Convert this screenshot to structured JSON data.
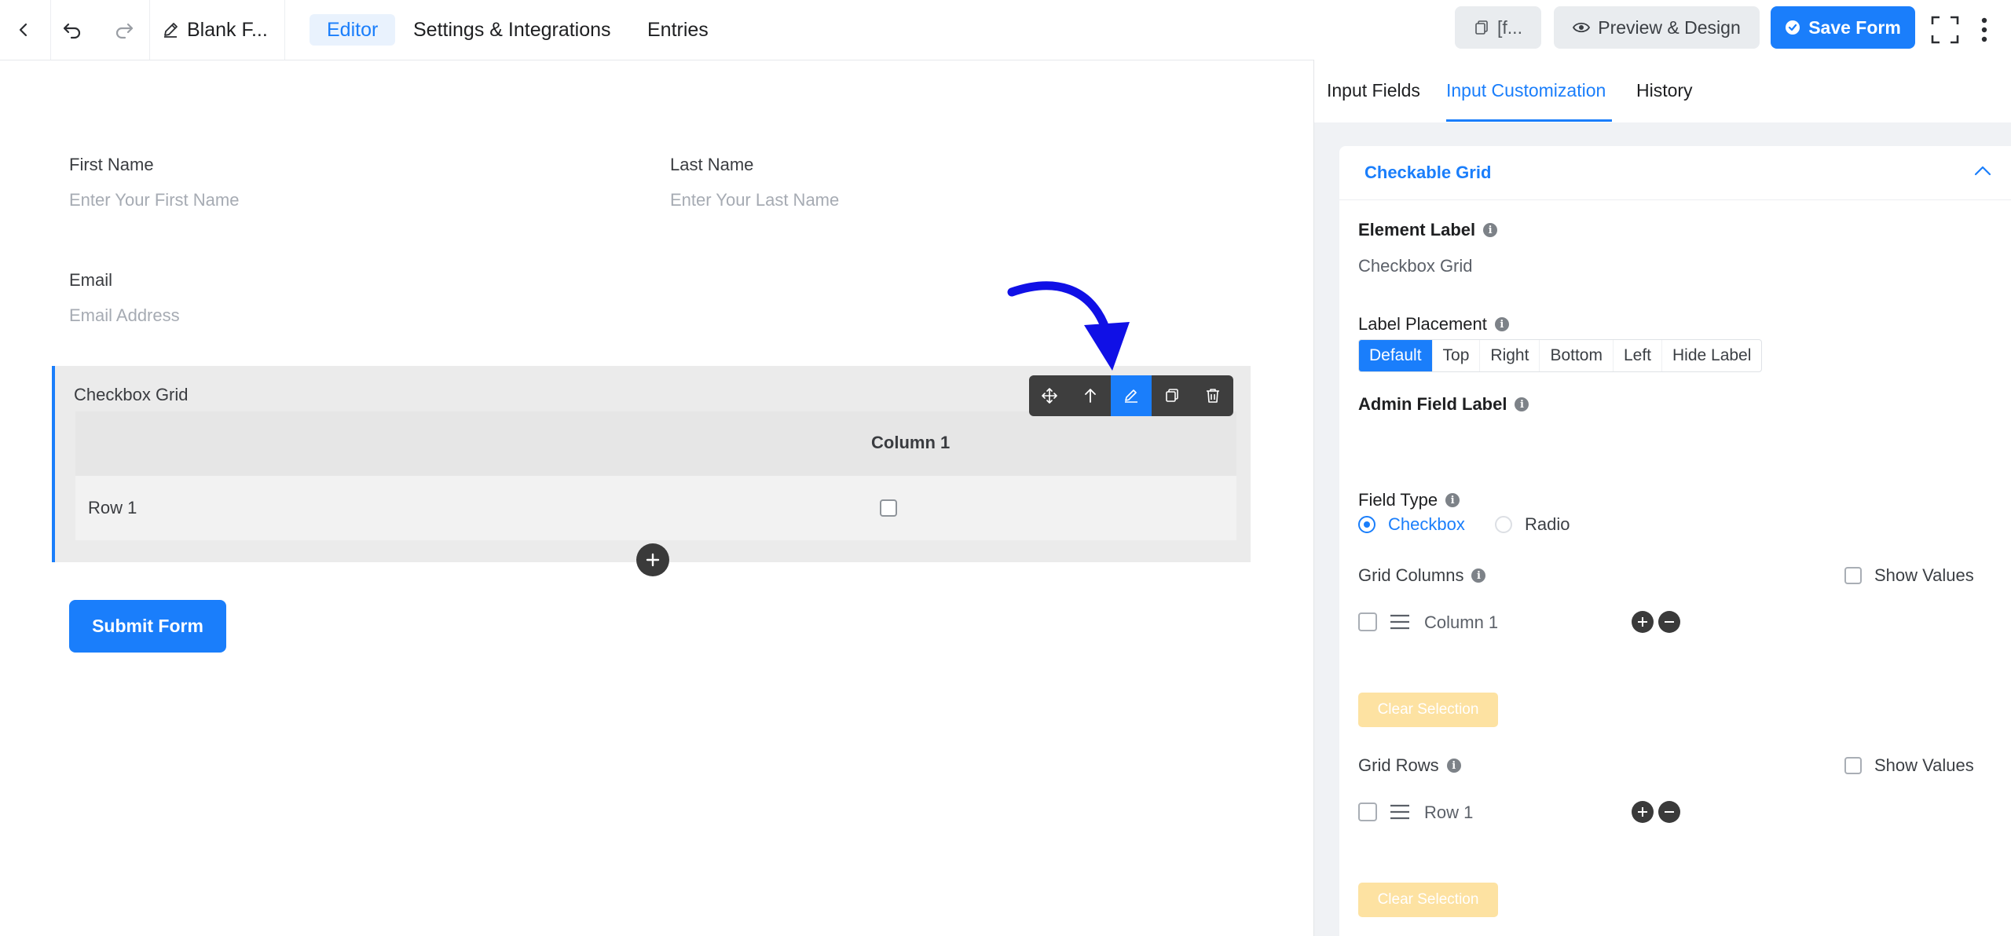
{
  "topbar": {
    "form_title": "Blank F...",
    "tabs": [
      {
        "label": "Editor"
      },
      {
        "label": "Settings & Integrations"
      },
      {
        "label": "Entries"
      }
    ],
    "shortcode_label": "[f...",
    "preview_label": "Preview & Design",
    "save_label": "Save Form"
  },
  "form": {
    "first_name": {
      "label": "First Name",
      "placeholder": "Enter Your First Name"
    },
    "last_name": {
      "label": "Last Name",
      "placeholder": "Enter Your Last Name"
    },
    "email": {
      "label": "Email",
      "placeholder": "Email Address"
    },
    "checkbox_grid": {
      "label": "Checkbox Grid",
      "columns": [
        "Column 1"
      ],
      "rows": [
        "Row 1"
      ]
    },
    "submit_label": "Submit Form"
  },
  "panel": {
    "tabs": [
      {
        "label": "Input Fields"
      },
      {
        "label": "Input Customization"
      },
      {
        "label": "History"
      }
    ],
    "section_title": "Checkable Grid",
    "element_label": {
      "label": "Element Label",
      "value": "Checkbox Grid"
    },
    "label_placement": {
      "label": "Label Placement",
      "options": [
        "Default",
        "Top",
        "Right",
        "Bottom",
        "Left",
        "Hide Label"
      ],
      "selected": "Default"
    },
    "admin_field_label": {
      "label": "Admin Field Label"
    },
    "field_type": {
      "label": "Field Type",
      "options": [
        "Checkbox",
        "Radio"
      ],
      "selected": "Checkbox"
    },
    "grid_columns": {
      "label": "Grid Columns",
      "show_values_label": "Show Values",
      "items": [
        "Column 1"
      ],
      "clear_label": "Clear Selection"
    },
    "grid_rows": {
      "label": "Grid Rows",
      "show_values_label": "Show Values",
      "items": [
        "Row 1"
      ],
      "clear_label": "Clear Selection"
    }
  },
  "colors": {
    "accent": "#1a7efb",
    "annotation_arrow": "#1010e6"
  }
}
